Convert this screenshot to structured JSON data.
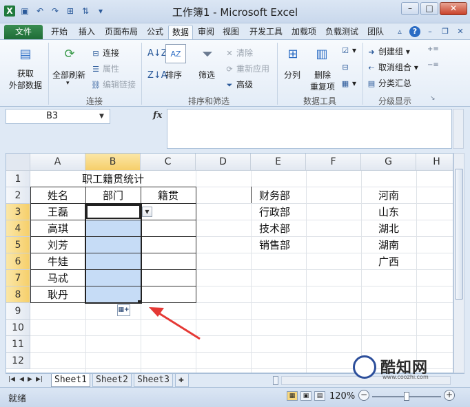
{
  "window": {
    "title": "工作簿1 - Microsoft Excel",
    "minimize": "–",
    "maximize": "□",
    "close": "✕"
  },
  "tabs": [
    "文件",
    "开始",
    "插入",
    "页面布局",
    "公式",
    "数据",
    "审阅",
    "视图",
    "开发工具",
    "加载项",
    "负载测试",
    "团队"
  ],
  "active_tab": "数据",
  "ribbon": {
    "get_external_data": [
      "获取",
      "外部数据"
    ],
    "refresh_all": "全部刷新",
    "connections": "连接",
    "properties": "属性",
    "edit_links": "编辑链接",
    "group_connections": "连接",
    "sort": "排序",
    "filter": "筛选",
    "clear": "清除",
    "reapply": "重新应用",
    "advanced": "高级",
    "group_sort_filter": "排序和筛选",
    "text_to_columns": "分列",
    "remove_duplicates": [
      "删除",
      "重复项"
    ],
    "group_data_tools": "数据工具",
    "group": "创建组",
    "ungroup": "取消组合",
    "subtotal": "分类汇总",
    "group_outline": "分级显示"
  },
  "formula_bar": {
    "name_box": "B3",
    "fx": "fx",
    "formula": ""
  },
  "grid": {
    "columns": [
      "A",
      "B",
      "C",
      "D",
      "E",
      "F",
      "G",
      "H"
    ],
    "rows": [
      "1",
      "2",
      "3",
      "4",
      "5",
      "6",
      "7",
      "8",
      "9",
      "10",
      "11",
      "12"
    ],
    "selected_column": "B",
    "selected_rows": [
      "3",
      "4",
      "5",
      "6",
      "7",
      "8"
    ],
    "title": "职工籍贯统计",
    "headers": [
      "姓名",
      "部门",
      "籍贯"
    ],
    "names": [
      "王磊",
      "高琪",
      "刘芳",
      "牛娃",
      "马忒",
      "耿丹"
    ],
    "departments": [
      "财务部",
      "行政部",
      "技术部",
      "销售部"
    ],
    "provinces": [
      "河南",
      "山东",
      "湖北",
      "湖南",
      "广西"
    ]
  },
  "sheets": [
    "Sheet1",
    "Sheet2",
    "Sheet3"
  ],
  "active_sheet": "Sheet1",
  "status": {
    "ready": "就绪",
    "zoom": "120%"
  },
  "watermark": {
    "name": "酷知网",
    "url": "www.coozhi.com"
  },
  "colors": {
    "selection_fill": "#c6dcf6",
    "header_highlight": "#f6cf6a",
    "excel_green": "#1d6b35",
    "arrow": "#e53935"
  }
}
